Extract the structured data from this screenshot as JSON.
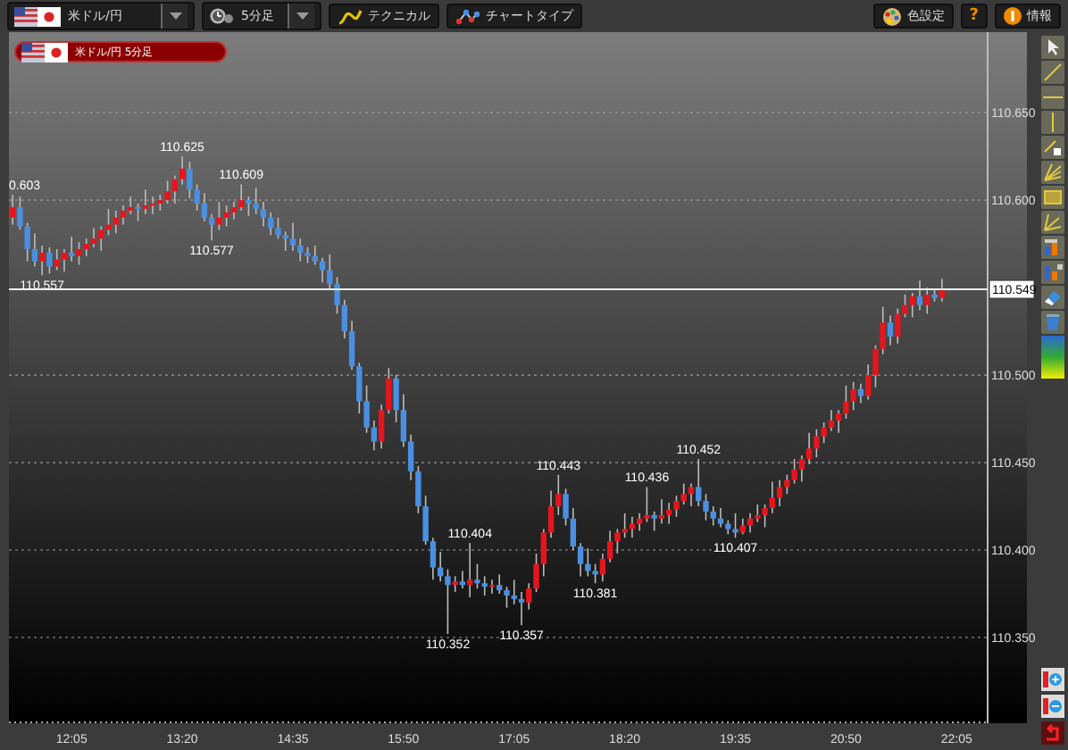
{
  "toolbar": {
    "pair_selector": {
      "value": "米ドル/円"
    },
    "timeframe_selector": {
      "value": "5分足"
    },
    "buttons": [
      {
        "label": "テクニカル",
        "kind": "technical"
      },
      {
        "label": "チャートタイプ",
        "kind": "chart_type"
      }
    ],
    "right_buttons": [
      {
        "label": "色設定",
        "kind": "color"
      },
      {
        "label": "?",
        "kind": "help"
      },
      {
        "label": "情報",
        "kind": "info"
      }
    ]
  },
  "chart": {
    "tag": "米ドル/円 5分足",
    "chart_data": {
      "type": "candlestick",
      "grid": true,
      "xlim": [
        682.5,
        1346
      ],
      "ylim": [
        110.301,
        110.696
      ],
      "xticks": [
        {
          "value": 725,
          "label": "12:05"
        },
        {
          "value": 800,
          "label": "13:20"
        },
        {
          "value": 875,
          "label": "14:35"
        },
        {
          "value": 950,
          "label": "15:50"
        },
        {
          "value": 1025,
          "label": "17:05"
        },
        {
          "value": 1100,
          "label": "18:20"
        },
        {
          "value": 1175,
          "label": "19:35"
        },
        {
          "value": 1250,
          "label": "20:50"
        },
        {
          "value": 1325,
          "label": "22:05"
        }
      ],
      "yticks": [
        {
          "value": 110.35,
          "label": "110.350"
        },
        {
          "value": 110.4,
          "label": "110.400"
        },
        {
          "value": 110.45,
          "label": "110.450"
        },
        {
          "value": 110.5,
          "label": "110.500"
        },
        {
          "value": 110.6,
          "label": "110.600"
        },
        {
          "value": 110.65,
          "label": "110.650"
        }
      ],
      "x": [
        685,
        690,
        695,
        700,
        705,
        710,
        715,
        720,
        725,
        730,
        735,
        740,
        745,
        750,
        755,
        760,
        765,
        770,
        775,
        780,
        785,
        790,
        795,
        800,
        805,
        810,
        815,
        820,
        825,
        830,
        835,
        840,
        845,
        850,
        855,
        860,
        865,
        870,
        875,
        880,
        885,
        890,
        895,
        900,
        905,
        910,
        915,
        920,
        925,
        930,
        935,
        940,
        945,
        950,
        955,
        960,
        965,
        970,
        975,
        980,
        985,
        990,
        995,
        1000,
        1005,
        1010,
        1015,
        1020,
        1025,
        1030,
        1035,
        1040,
        1045,
        1050,
        1055,
        1060,
        1065,
        1070,
        1075,
        1080,
        1085,
        1090,
        1095,
        1100,
        1105,
        1110,
        1115,
        1120,
        1125,
        1130,
        1135,
        1140,
        1145,
        1150,
        1155,
        1160,
        1165,
        1170,
        1175,
        1180,
        1185,
        1190,
        1195,
        1200,
        1205,
        1210,
        1215,
        1220,
        1225,
        1230,
        1235,
        1240,
        1245,
        1250,
        1255,
        1260,
        1265,
        1270,
        1275,
        1280,
        1285,
        1290,
        1295,
        1300,
        1305,
        1310,
        1315
      ],
      "ohlc": [
        [
          110.59,
          110.603,
          110.586,
          110.596
        ],
        [
          110.596,
          110.602,
          110.583,
          110.585
        ],
        [
          110.585,
          110.587,
          110.565,
          110.572
        ],
        [
          110.572,
          110.581,
          110.562,
          110.565
        ],
        [
          110.565,
          110.574,
          110.557,
          110.57
        ],
        [
          110.57,
          110.573,
          110.558,
          110.562
        ],
        [
          110.562,
          110.572,
          110.56,
          110.566
        ],
        [
          110.566,
          110.572,
          110.559,
          110.57
        ],
        [
          110.57,
          110.579,
          110.565,
          110.568
        ],
        [
          110.568,
          110.576,
          110.563,
          110.572
        ],
        [
          110.572,
          110.578,
          110.568,
          110.575
        ],
        [
          110.575,
          110.584,
          110.573,
          110.578
        ],
        [
          110.578,
          110.585,
          110.571,
          110.583
        ],
        [
          110.583,
          110.595,
          110.58,
          110.586
        ],
        [
          110.586,
          110.594,
          110.581,
          110.59
        ],
        [
          110.59,
          110.597,
          110.586,
          110.594
        ],
        [
          110.594,
          110.602,
          110.592,
          110.596
        ],
        [
          110.596,
          110.598,
          110.588,
          110.595
        ],
        [
          110.595,
          110.606,
          110.592,
          110.597
        ],
        [
          110.597,
          110.602,
          110.592,
          110.598
        ],
        [
          110.598,
          110.603,
          110.594,
          110.6
        ],
        [
          110.6,
          110.611,
          110.598,
          110.605
        ],
        [
          110.605,
          110.614,
          110.598,
          110.612
        ],
        [
          110.612,
          110.625,
          110.609,
          110.618
        ],
        [
          110.618,
          110.622,
          110.601,
          110.606
        ],
        [
          110.606,
          110.609,
          110.594,
          110.598
        ],
        [
          110.598,
          110.604,
          110.588,
          110.59
        ],
        [
          110.59,
          110.592,
          110.577,
          110.586
        ],
        [
          110.586,
          110.599,
          110.583,
          110.59
        ],
        [
          110.59,
          110.597,
          110.585,
          110.593
        ],
        [
          110.593,
          110.599,
          110.589,
          110.596
        ],
        [
          110.596,
          110.609,
          110.594,
          110.6
        ],
        [
          110.6,
          110.602,
          110.591,
          110.598
        ],
        [
          110.598,
          110.607,
          110.592,
          110.595
        ],
        [
          110.595,
          110.599,
          110.585,
          110.59
        ],
        [
          110.59,
          110.593,
          110.58,
          110.584
        ],
        [
          110.584,
          110.59,
          110.578,
          110.58
        ],
        [
          110.58,
          110.582,
          110.571,
          110.578
        ],
        [
          110.578,
          110.587,
          110.571,
          110.574
        ],
        [
          110.574,
          110.578,
          110.565,
          110.57
        ],
        [
          110.57,
          110.573,
          110.564,
          110.568
        ],
        [
          110.568,
          110.574,
          110.563,
          110.565
        ],
        [
          110.565,
          110.567,
          110.553,
          110.56
        ],
        [
          110.56,
          110.569,
          110.549,
          110.552
        ],
        [
          110.552,
          110.556,
          110.535,
          110.54
        ],
        [
          110.54,
          110.543,
          110.521,
          110.525
        ],
        [
          110.525,
          110.531,
          110.503,
          110.505
        ],
        [
          110.505,
          110.507,
          110.478,
          110.485
        ],
        [
          110.485,
          110.494,
          110.467,
          110.47
        ],
        [
          110.47,
          110.474,
          110.457,
          110.462
        ],
        [
          110.462,
          110.483,
          110.458,
          110.48
        ],
        [
          110.48,
          110.504,
          110.478,
          110.498
        ],
        [
          110.498,
          110.5,
          110.473,
          110.48
        ],
        [
          110.48,
          110.489,
          110.459,
          110.462
        ],
        [
          110.462,
          110.466,
          110.44,
          110.445
        ],
        [
          110.445,
          110.448,
          110.421,
          110.425
        ],
        [
          110.425,
          110.431,
          110.403,
          110.405
        ],
        [
          110.405,
          110.407,
          110.383,
          110.39
        ],
        [
          110.39,
          110.399,
          110.382,
          110.385
        ],
        [
          110.385,
          110.389,
          110.352,
          110.38
        ],
        [
          110.38,
          110.385,
          110.376,
          110.382
        ],
        [
          110.382,
          110.388,
          110.378,
          110.38
        ],
        [
          110.38,
          110.404,
          110.373,
          110.383
        ],
        [
          110.383,
          110.392,
          110.378,
          110.381
        ],
        [
          110.381,
          110.385,
          110.374,
          110.379
        ],
        [
          110.379,
          110.383,
          110.375,
          110.38
        ],
        [
          110.38,
          110.386,
          110.375,
          110.377
        ],
        [
          110.377,
          110.379,
          110.367,
          110.374
        ],
        [
          110.374,
          110.383,
          110.369,
          110.372
        ],
        [
          110.372,
          110.376,
          110.357,
          110.37
        ],
        [
          110.37,
          110.381,
          110.366,
          110.378
        ],
        [
          110.378,
          110.398,
          110.376,
          110.392
        ],
        [
          110.392,
          110.412,
          110.385,
          110.41
        ],
        [
          110.41,
          110.434,
          110.407,
          110.425
        ],
        [
          110.425,
          110.443,
          110.42,
          110.432
        ],
        [
          110.432,
          110.435,
          110.414,
          110.418
        ],
        [
          110.418,
          110.424,
          110.4,
          110.402
        ],
        [
          110.402,
          110.404,
          110.385,
          110.392
        ],
        [
          110.392,
          110.401,
          110.385,
          110.388
        ],
        [
          110.388,
          110.392,
          110.381,
          110.386
        ],
        [
          110.386,
          110.398,
          110.382,
          110.395
        ],
        [
          110.395,
          110.411,
          110.393,
          110.405
        ],
        [
          110.405,
          110.412,
          110.398,
          110.41
        ],
        [
          110.41,
          110.421,
          110.407,
          110.412
        ],
        [
          110.412,
          110.419,
          110.407,
          110.415
        ],
        [
          110.415,
          110.421,
          110.411,
          110.418
        ],
        [
          110.418,
          110.436,
          110.416,
          110.42
        ],
        [
          110.42,
          110.422,
          110.411,
          110.418
        ],
        [
          110.418,
          110.429,
          110.415,
          110.42
        ],
        [
          110.42,
          110.427,
          110.415,
          110.423
        ],
        [
          110.423,
          110.431,
          110.419,
          110.428
        ],
        [
          110.428,
          110.438,
          110.426,
          110.432
        ],
        [
          110.432,
          110.438,
          110.425,
          110.436
        ],
        [
          110.436,
          110.452,
          110.425,
          110.428
        ],
        [
          110.428,
          110.432,
          110.417,
          110.422
        ],
        [
          110.422,
          110.425,
          110.414,
          110.418
        ],
        [
          110.418,
          110.424,
          110.413,
          110.415
        ],
        [
          110.415,
          110.417,
          110.409,
          110.412
        ],
        [
          110.412,
          110.421,
          110.407,
          110.41
        ],
        [
          110.41,
          110.418,
          110.409,
          110.414
        ],
        [
          110.414,
          110.421,
          110.41,
          110.418
        ],
        [
          110.418,
          110.426,
          110.416,
          110.42
        ],
        [
          110.42,
          110.426,
          110.413,
          110.424
        ],
        [
          110.424,
          110.439,
          110.421,
          110.43
        ],
        [
          110.43,
          110.44,
          110.425,
          110.436
        ],
        [
          110.436,
          110.443,
          110.432,
          110.44
        ],
        [
          110.44,
          110.452,
          110.438,
          110.446
        ],
        [
          110.446,
          110.454,
          110.439,
          110.452
        ],
        [
          110.452,
          110.467,
          110.449,
          110.458
        ],
        [
          110.458,
          110.469,
          110.453,
          110.465
        ],
        [
          110.465,
          110.473,
          110.461,
          110.47
        ],
        [
          110.47,
          110.48,
          110.468,
          110.474
        ],
        [
          110.474,
          110.48,
          110.467,
          110.478
        ],
        [
          110.478,
          110.494,
          110.475,
          110.485
        ],
        [
          110.485,
          110.496,
          110.48,
          110.492
        ],
        [
          110.492,
          110.495,
          110.484,
          110.488
        ],
        [
          110.488,
          110.506,
          110.486,
          110.5
        ],
        [
          110.5,
          110.517,
          110.493,
          110.515
        ],
        [
          110.515,
          110.539,
          110.512,
          110.53
        ],
        [
          110.53,
          110.534,
          110.517,
          110.522
        ],
        [
          110.522,
          110.538,
          110.518,
          110.535
        ],
        [
          110.535,
          110.546,
          110.533,
          110.54
        ],
        [
          110.54,
          110.547,
          110.533,
          110.545
        ],
        [
          110.545,
          110.554,
          110.537,
          110.54
        ],
        [
          110.54,
          110.55,
          110.535,
          110.546
        ],
        [
          110.546,
          110.549,
          110.542,
          110.544
        ],
        [
          110.544,
          110.555,
          110.542,
          110.549
        ]
      ],
      "ref_lines": [
        {
          "axis": "y",
          "value": 110.549,
          "label": "110.549"
        }
      ],
      "annotations": [
        {
          "x": 685,
          "y": 110.603,
          "text": "0.603"
        },
        {
          "x": 705,
          "y": 110.557,
          "text": "110.557"
        },
        {
          "x": 800,
          "y": 110.625,
          "text": "110.625"
        },
        {
          "x": 840,
          "y": 110.609,
          "text": "110.609"
        },
        {
          "x": 820,
          "y": 110.577,
          "text": "110.577"
        },
        {
          "x": 1055,
          "y": 110.443,
          "text": "110.443"
        },
        {
          "x": 995,
          "y": 110.404,
          "text": "110.404"
        },
        {
          "x": 1080,
          "y": 110.381,
          "text": "110.381"
        },
        {
          "x": 980,
          "y": 110.352,
          "text": "110.352"
        },
        {
          "x": 1030,
          "y": 110.357,
          "text": "110.357"
        },
        {
          "x": 1115,
          "y": 110.436,
          "text": "110.436"
        },
        {
          "x": 1150,
          "y": 110.452,
          "text": "110.452"
        },
        {
          "x": 1175,
          "y": 110.407,
          "text": "110.407"
        }
      ]
    }
  }
}
